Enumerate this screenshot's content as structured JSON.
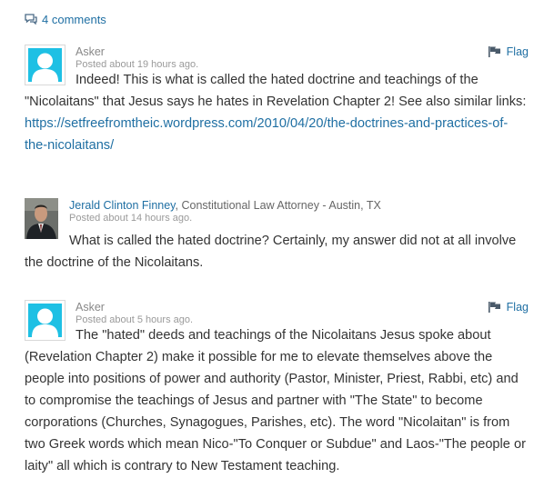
{
  "header": {
    "comments_count_label": "4 comments"
  },
  "comments": [
    {
      "author": "Asker",
      "posted": "Posted about 19 hours ago.",
      "flag_label": "Flag",
      "text": "Indeed! This is what is called the hated doctrine and teachings of the \"Nicolaitans\" that Jesus says he hates in Revelation Chapter 2! See also similar links: ",
      "link": "https://setfreefromtheic.wordpress.com/2010/04/20/the-doctrines-and-practices-of-the-nicolaitans/"
    },
    {
      "author": "Jerald Clinton Finney",
      "author_title": "Constitutional Law Attorney - Austin, TX",
      "separator": ",",
      "posted": "Posted about 14 hours ago.",
      "text": "What is called the hated doctrine? Certainly, my answer did not at all involve the doctrine of the Nicolaitans."
    },
    {
      "author": "Asker",
      "posted": "Posted about 5 hours ago.",
      "flag_label": "Flag",
      "text": "The \"hated\" deeds and teachings of the Nicolaitans Jesus spoke about (Revelation Chapter 2) make it possible for me to elevate themselves above the people into positions of power and authority (Pastor, Minister, Priest, Rabbi, etc) and to compromise the teachings of Jesus and partner with \"The State\" to become corporations (Churches, Synagogues, Parishes, etc). The word \"Nicolaitan\" is from two Greek words which mean Nico-\"To Conquer or Subdue\" and Laos-\"The people or laity\" all which is contrary to New Testament teaching."
    }
  ],
  "colors": {
    "link": "#1f6fa3",
    "avatar_placeholder": "#1ec0e4",
    "text": "#333333",
    "muted": "#9a9a9a"
  },
  "icons": [
    "comments-icon",
    "flag-icon",
    "default-avatar-icon",
    "user-photo"
  ]
}
